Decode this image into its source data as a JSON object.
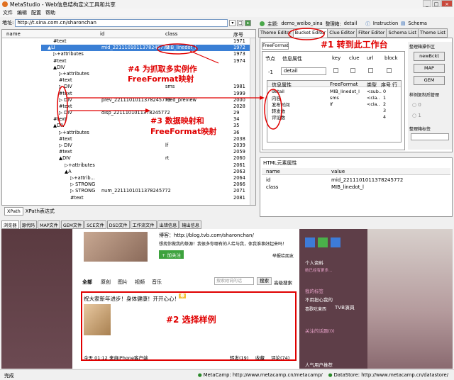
{
  "window": {
    "title": "MetaStudio - Web信息结构定义工具和共享",
    "controls": [
      "_",
      "□",
      "×"
    ]
  },
  "menu": [
    "文件",
    "编辑",
    "配置",
    "帮助"
  ],
  "address": {
    "label": "地址:",
    "value": "http://t.sina.com.cn/sharonchan"
  },
  "tree": {
    "headers": {
      "name": "name",
      "id": "id",
      "class": "class",
      "seq": "序号"
    },
    "rows": [
      {
        "indent": 2,
        "text": "#text",
        "id": "",
        "cls": "",
        "seq": "1971"
      },
      {
        "indent": 1,
        "text": "▲LI",
        "id": "mid_2211101011378245772",
        "cls": "MIB_linedot_l",
        "seq": "1972",
        "selected": true
      },
      {
        "indent": 2,
        "text": "▷+attributes",
        "id": "",
        "cls": "",
        "seq": "1973"
      },
      {
        "indent": 2,
        "text": "#text",
        "id": "",
        "cls": "",
        "seq": "1974"
      },
      {
        "indent": 2,
        "text": "▲DIV",
        "id": "",
        "cls": "",
        "seq": ""
      },
      {
        "indent": 3,
        "text": "▷+attributes",
        "id": "",
        "cls": "",
        "seq": ""
      },
      {
        "indent": 3,
        "text": "#text",
        "id": "",
        "cls": "",
        "seq": ""
      },
      {
        "indent": 3,
        "text": "▷ DIV",
        "id": "",
        "cls": "sms",
        "seq": "1981"
      },
      {
        "indent": 3,
        "text": "#text",
        "id": "",
        "cls": "",
        "seq": "1999"
      },
      {
        "indent": 3,
        "text": "▷ DIV",
        "id": "prev_2211101011378245772",
        "cls": "feed_preview",
        "seq": "2000"
      },
      {
        "indent": 3,
        "text": "#text",
        "id": "",
        "cls": "",
        "seq": "2028"
      },
      {
        "indent": 3,
        "text": "▷ DIV",
        "id": "disp_2211101011378245772",
        "cls": "",
        "seq": "29"
      },
      {
        "indent": 2,
        "text": "#text",
        "id": "",
        "cls": "",
        "seq": "34"
      },
      {
        "indent": 2,
        "text": "▲DIV",
        "id": "",
        "cls": "",
        "seq": "35"
      },
      {
        "indent": 3,
        "text": "▷+attributes",
        "id": "",
        "cls": "",
        "seq": "36"
      },
      {
        "indent": 3,
        "text": "#text",
        "id": "",
        "cls": "",
        "seq": "2038"
      },
      {
        "indent": 3,
        "text": "▷ DIV",
        "id": "",
        "cls": "lf",
        "seq": "2039"
      },
      {
        "indent": 3,
        "text": "#text",
        "id": "",
        "cls": "",
        "seq": "2059"
      },
      {
        "indent": 3,
        "text": "▲DIV",
        "id": "",
        "cls": "rt",
        "seq": "2060"
      },
      {
        "indent": 4,
        "text": "▷+attributes",
        "id": "",
        "cls": "",
        "seq": "2061"
      },
      {
        "indent": 4,
        "text": "▲A",
        "id": "",
        "cls": "",
        "seq": "2063"
      },
      {
        "indent": 5,
        "text": "▷+attrib...",
        "id": "",
        "cls": "",
        "seq": "2064"
      },
      {
        "indent": 5,
        "text": "▷ STRONG",
        "id": "",
        "cls": "",
        "seq": "2066"
      },
      {
        "indent": 5,
        "text": "▷ STRONG",
        "id": "num_2211101011378245772",
        "cls": "",
        "seq": "2071"
      },
      {
        "indent": 5,
        "text": "#text",
        "id": "",
        "cls": "",
        "seq": "2081"
      }
    ]
  },
  "xpath_tabs": [
    "XPath",
    "XPath表达式"
  ],
  "theme_bar": {
    "theme_label": "主题:",
    "theme_value": "demo_weibo_sina",
    "org_label": "整理箱:",
    "org_value": "detail",
    "instruction": "Instruction",
    "schema": "Schema"
  },
  "right_tabs": [
    "Theme Editor",
    "Bucket Editor",
    "Clue Editor",
    "Filter Editor",
    "Schema List",
    "Theme List"
  ],
  "bucket": {
    "freeformat_tab": "FreeFormat",
    "cols": [
      "节点",
      "信息属性",
      "key",
      "clue",
      "url",
      "block"
    ],
    "row_num": "-1",
    "row_value": "detail",
    "sub_cols": [
      "信息属性",
      "FreeFormat",
      "类型",
      "序号",
      "行"
    ],
    "sub_rows": [
      {
        "attr": "detail",
        "ff": "MIB_linedot_l",
        "type": "<sub..",
        "seq": "0"
      },
      {
        "attr": "内容",
        "ff": "sms",
        "type": "<cla..",
        "seq": "1"
      },
      {
        "attr": "发布时间",
        "ff": "lf",
        "type": "<cla..",
        "seq": "2"
      },
      {
        "attr": "转发数",
        "ff": "",
        "type": "",
        "seq": "3"
      },
      {
        "attr": "评论数",
        "ff": "",
        "type": "",
        "seq": "4"
      }
    ]
  },
  "right_side": {
    "group1": "整理箱操作区",
    "btn_new": "newBckt",
    "btn_map": "MAP",
    "btn_gem": "GEM",
    "group2": "样例复制后管理",
    "radio0": "0",
    "radio1": "1",
    "group3": "整理箱标签"
  },
  "html_attr": {
    "title": "HTML元素属性",
    "cols": [
      "name",
      "value"
    ],
    "rows": [
      {
        "name": "id",
        "value": "mid_2211101011378245772"
      },
      {
        "name": "class",
        "value": "MIB_linedot_l"
      }
    ]
  },
  "bottom_tabs": [
    "浏览器",
    "源代码",
    "MAP文件",
    "GEM文件",
    "SCE文件",
    "DSD文件",
    "工作流文件",
    "出错信息",
    "输出信息"
  ],
  "browser": {
    "blog_line": "博客：http://blog.tvb.com/sharonchan/",
    "intro": "想找你做我的祭源！我很多你哪有的人给与我，体我谁事好起来吗！",
    "follow": "+ 加关注",
    "report": "举报给朋友",
    "filters": [
      "全部",
      "原创",
      "图片",
      "视频",
      "音乐"
    ],
    "search_ph": "搜索她说的话",
    "search_btn": "搜索",
    "adv": "高级搜索",
    "post": "祝大家新年进步！身体健康！开开心心！",
    "post_time": "今天 01:12",
    "post_client": "来自iPhone客户端",
    "forward": "转发(19)",
    "fav": "收藏",
    "comment": "评论(74)",
    "side_info": "个人资料",
    "side_more": "她已经有更多...",
    "side_tags": "我的标签",
    "side_tag1": "不用担心我的",
    "side_tag2": "喜歡吃東西",
    "side_tag3": "TVB演員",
    "side_topic": "关注的话题(0)",
    "side_hot": "人气用户推荐"
  },
  "annotations": {
    "a1": "#1 转到此工作台",
    "a2": "#2 选择样例",
    "a3a": "#3 数据映射和",
    "a3b": "FreeFormat映射",
    "a4a": "#4 为抓取多实例作",
    "a4b": "FreeFormat映射"
  },
  "status": {
    "left": "完成",
    "metacamp": "MetaCamp: http://www.metacamp.cn/metacamp/",
    "datastore": "DataStore: http://www.metacamp.cn/datastore/"
  }
}
